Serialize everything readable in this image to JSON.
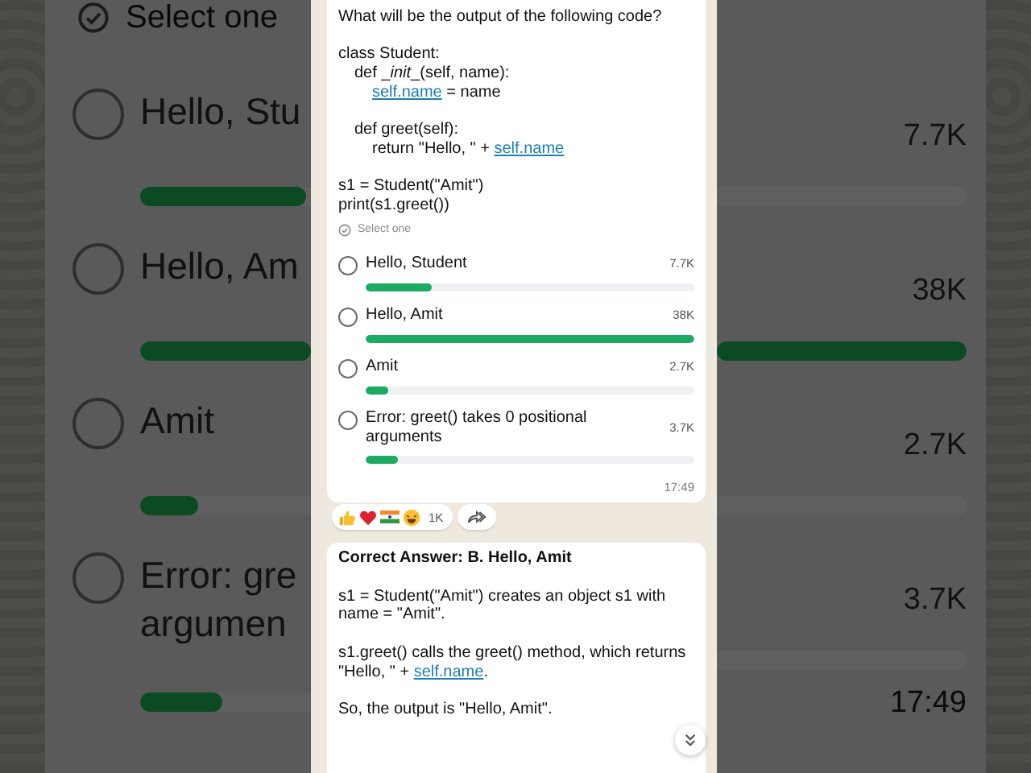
{
  "background": {
    "hint": "Select one",
    "options": [
      {
        "lines": [
          "Hello, Stu"
        ],
        "count": "7.7K",
        "selected": false
      },
      {
        "lines": [
          "Hello, Am"
        ],
        "count": "38K",
        "selected": false
      },
      {
        "lines": [
          "Amit"
        ],
        "count": "2.7K",
        "selected": false
      },
      {
        "lines": [
          "Error: gre",
          "argumen"
        ],
        "count": "3.7K",
        "selected": false
      }
    ],
    "time": "17:49"
  },
  "poll": {
    "question": "What will be the output of the following code?",
    "code_blocks": [
      [
        {
          "segments": [
            {
              "kind": "text",
              "text": "class Student:"
            }
          ],
          "blank_before": false,
          "children": [
            {
              "segments": [
                {
                  "kind": "text",
                  "text": "def _"
                },
                {
                  "kind": "italic",
                  "text": "init"
                },
                {
                  "kind": "text",
                  "text": "_(self, name):"
                }
              ],
              "blank_before": false,
              "children": [
                {
                  "segments": [
                    {
                      "kind": "link",
                      "text": "self.name"
                    },
                    {
                      "kind": "text",
                      "text": " = name"
                    }
                  ],
                  "blank_before": false
                }
              ]
            },
            {
              "segments": [
                {
                  "kind": "text",
                  "text": "def greet(self):"
                }
              ],
              "blank_before": true,
              "children": [
                {
                  "segments": [
                    {
                      "kind": "text",
                      "text": "return \"Hello, \" + "
                    },
                    {
                      "kind": "link",
                      "text": "self.name"
                    }
                  ],
                  "blank_before": false
                }
              ]
            }
          ]
        }
      ],
      [
        {
          "segments": [
            {
              "kind": "text",
              "text": "s1 = Student(\"Amit\")"
            }
          ],
          "blank_before": false
        },
        {
          "segments": [
            {
              "kind": "text",
              "text": "print(s1.greet())"
            }
          ],
          "blank_before": false
        }
      ]
    ],
    "hint": "Select one",
    "options": [
      {
        "label": "Hello, Student",
        "count": "7.7K",
        "level": 0.2,
        "selected": false
      },
      {
        "label": "Hello, Amit",
        "count": "38K",
        "level": 1,
        "selected": false
      },
      {
        "label": "Amit",
        "count": "2.7K",
        "level": 0.07,
        "selected": false
      },
      {
        "label": "Error: greet() takes 0 positional arguments",
        "count": "3.7K",
        "level": 0.1,
        "selected": false
      }
    ],
    "time": "17:49"
  },
  "reactions": {
    "count": "1K"
  },
  "answer": {
    "title": "Correct Answer: B. Hello, Amit",
    "paragraphs": [
      [
        {
          "kind": "text",
          "text": "s1 = Student(\"Amit\") creates an object s1 with name = \"Amit\"."
        }
      ],
      [
        {
          "kind": "text",
          "text": "s1.greet() calls the greet() method, which returns \"Hello, \" + "
        },
        {
          "kind": "link",
          "text": "self.name"
        },
        {
          "kind": "text",
          "text": "."
        }
      ],
      [
        {
          "kind": "text",
          "text": "So, the output is \"Hello, Amit\"."
        }
      ]
    ]
  }
}
